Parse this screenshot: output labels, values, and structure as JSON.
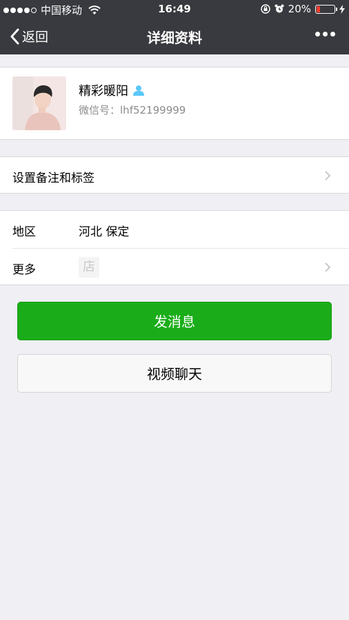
{
  "status_bar": {
    "carrier": "中国移动",
    "time": "16:49",
    "battery_percent_text": "20%",
    "battery_level": 0.2
  },
  "nav": {
    "back_label": "返回",
    "title": "详细资料"
  },
  "profile": {
    "name": "精彩暖阳",
    "wechat_id_label": "微信号：",
    "wechat_id": "lhf52199999"
  },
  "settings_row": {
    "label": "设置备注和标签"
  },
  "info_rows": {
    "region_label": "地区",
    "region_value": "河北 保定",
    "more_label": "更多",
    "shop_glyph": "店"
  },
  "buttons": {
    "send_message": "发消息",
    "video_chat": "视频聊天"
  },
  "colors": {
    "nav_bg": "#393a3f",
    "primary_green": "#1aad19",
    "page_bg": "#efeff4",
    "battery_low": "#ff3b30"
  },
  "icons": [
    "wifi-icon",
    "alarm-icon",
    "lock-rotation-icon",
    "charging-icon",
    "back-chevron-icon",
    "more-dots-icon",
    "contact-badge-icon",
    "chevron-right-icon",
    "shop-icon"
  ]
}
